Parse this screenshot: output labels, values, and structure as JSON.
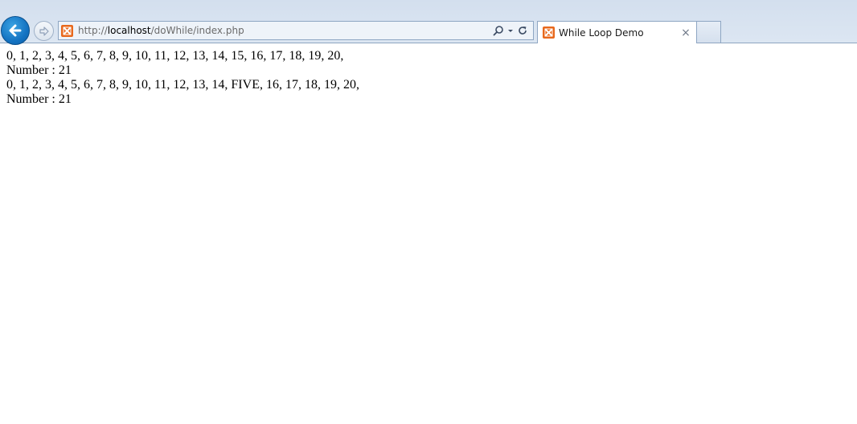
{
  "browser": {
    "url_prefix": "http://",
    "url_host": "localhost",
    "url_path": "/doWhile/index.php",
    "tab_title": "While Loop Demo",
    "tab_close": "×",
    "favicon": "xampp-icon",
    "colors": {
      "back_button": "#1473c2",
      "favicon": "#e8681c",
      "chrome": "#d3dfee"
    }
  },
  "page": {
    "lines": [
      "0, 1, 2, 3, 4, 5, 6, 7, 8, 9, 10, 11, 12, 13, 14, 15, 16, 17, 18, 19, 20,",
      "Number : 21",
      "0, 1, 2, 3, 4, 5, 6, 7, 8, 9, 10, 11, 12, 13, 14, FIVE, 16, 17, 18, 19, 20,",
      "Number : 21"
    ]
  }
}
